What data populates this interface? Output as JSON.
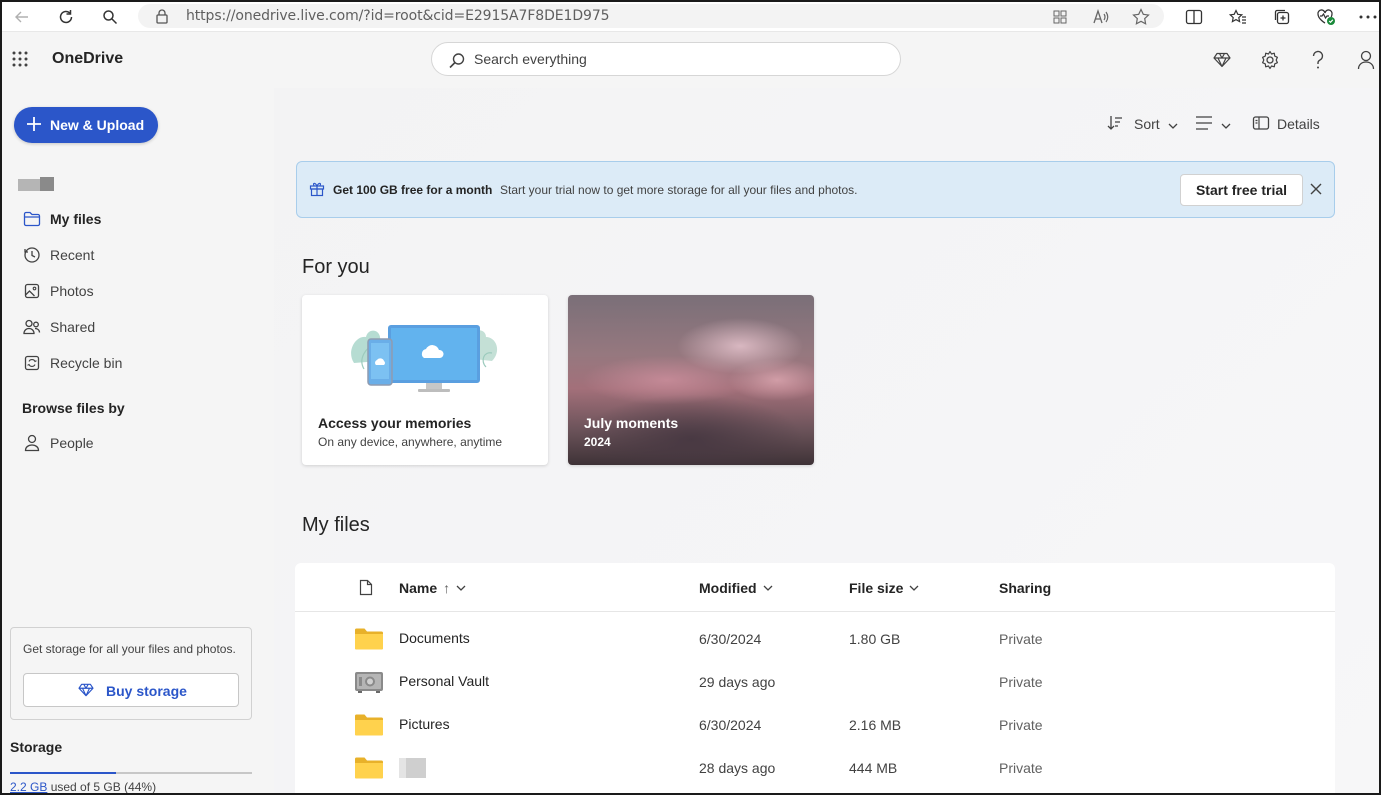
{
  "browser": {
    "url": "https://onedrive.live.com/?id=root&cid=E2915A7F8DE1D975"
  },
  "app": {
    "title": "OneDrive"
  },
  "search": {
    "placeholder": "Search everything"
  },
  "sidebar": {
    "new_upload_label": "New & Upload",
    "items": [
      {
        "label": "My files",
        "icon": "folder-icon",
        "active": true
      },
      {
        "label": "Recent",
        "icon": "clock-icon"
      },
      {
        "label": "Photos",
        "icon": "image-icon"
      },
      {
        "label": "Shared",
        "icon": "people-icon"
      },
      {
        "label": "Recycle bin",
        "icon": "recycle-bin-icon"
      }
    ],
    "browse_title": "Browse files by",
    "browse_items": [
      {
        "label": "People",
        "icon": "person-icon"
      }
    ],
    "promo_text": "Get storage for all your files and photos.",
    "buy_storage_label": "Buy storage",
    "storage_title": "Storage",
    "storage_used": "2.2 GB",
    "storage_rest": " used of 5 GB (44%)",
    "storage_fraction": 0.44
  },
  "toolbar": {
    "sort_label": "Sort",
    "details_label": "Details"
  },
  "banner": {
    "bold_text": "Get 100 GB free for a month",
    "description": "Start your trial now to get more storage for all your files and photos.",
    "button_label": "Start free trial"
  },
  "for_you": {
    "title": "For you",
    "cards": [
      {
        "title": "Access your memories",
        "subtitle": "On any device, anywhere, anytime"
      },
      {
        "title": "July moments",
        "subtitle": "2024"
      }
    ]
  },
  "my_files": {
    "title": "My files",
    "columns": {
      "name": "Name",
      "name_sort": "↑",
      "modified": "Modified",
      "size": "File size",
      "sharing": "Sharing"
    },
    "rows": [
      {
        "name": "Documents",
        "type": "folder",
        "modified": "6/30/2024",
        "size": "1.80 GB",
        "sharing": "Private"
      },
      {
        "name": "Personal Vault",
        "type": "vault",
        "modified": "29 days ago",
        "size": "",
        "sharing": "Private"
      },
      {
        "name": "Pictures",
        "type": "folder",
        "modified": "6/30/2024",
        "size": "2.16 MB",
        "sharing": "Private"
      },
      {
        "name": "",
        "type": "folder",
        "modified": "28 days ago",
        "size": "444 MB",
        "sharing": "Private"
      }
    ]
  },
  "colors": {
    "accent": "#2b56c9",
    "banner_bg": "#dcebf7",
    "folder": "#f5c842"
  }
}
